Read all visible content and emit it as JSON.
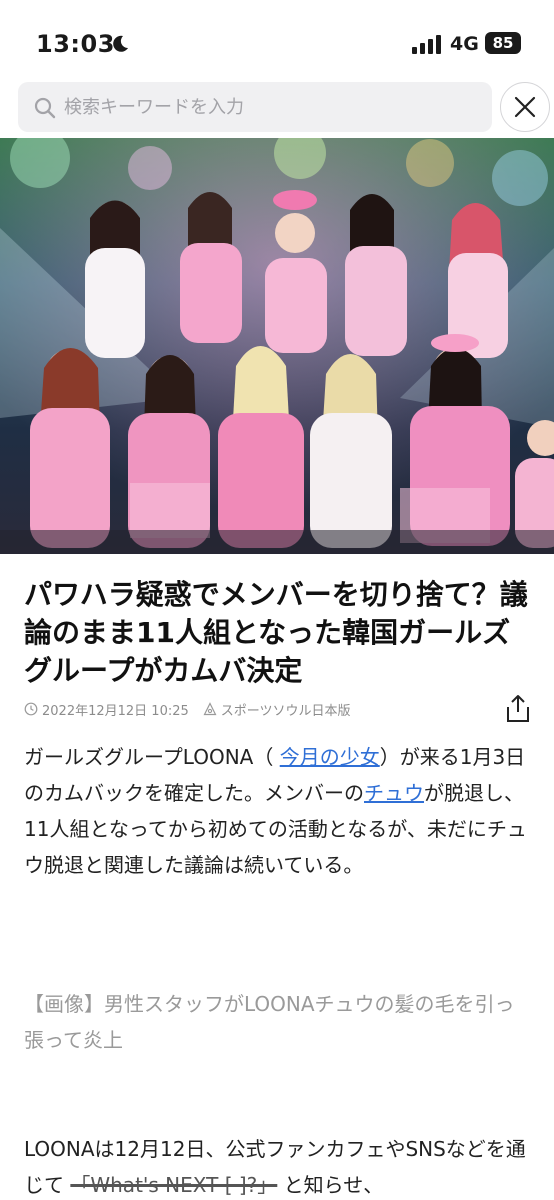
{
  "status_bar": {
    "time": "13:03",
    "network": "4G",
    "battery": "85"
  },
  "search": {
    "placeholder": "検索キーワードを入力"
  },
  "article": {
    "title": "パワハラ疑惑でメンバーを切り捨て？議論のまま11人組となった韓国ガールズグループがカムバ決定",
    "date": "2022年12月12日 10:25",
    "source": "スポーツソウル日本版",
    "p1": {
      "part1": "ガールズグループLOONA（ ",
      "link1": "今月の少女",
      "part2": "）が来る1月3日のカムバックを確定した。メンバーの",
      "link2": "チュウ",
      "part3": "が脱退し、11人組となってから初めての活動となるが、未だにチュウ脱退と関連した議論は続いている。"
    },
    "caption": "【画像】男性スタッフがLOONAチュウの髪の毛を引っ張って炎上",
    "p2": {
      "part1": "LOONAは12月12日、公式ファンカフェやSNSなどを通じて ",
      "quote": "「What's NEXT [ ]?」",
      "part2": " と知らせ、"
    }
  },
  "colors": {
    "link": "#2f6fd6",
    "caption": "#9a9a9a",
    "meta": "#8c8c8c"
  },
  "icons": [
    "moon-icon",
    "signal-icon",
    "search-icon",
    "close-icon",
    "clock-icon",
    "source-icon",
    "share-icon"
  ]
}
